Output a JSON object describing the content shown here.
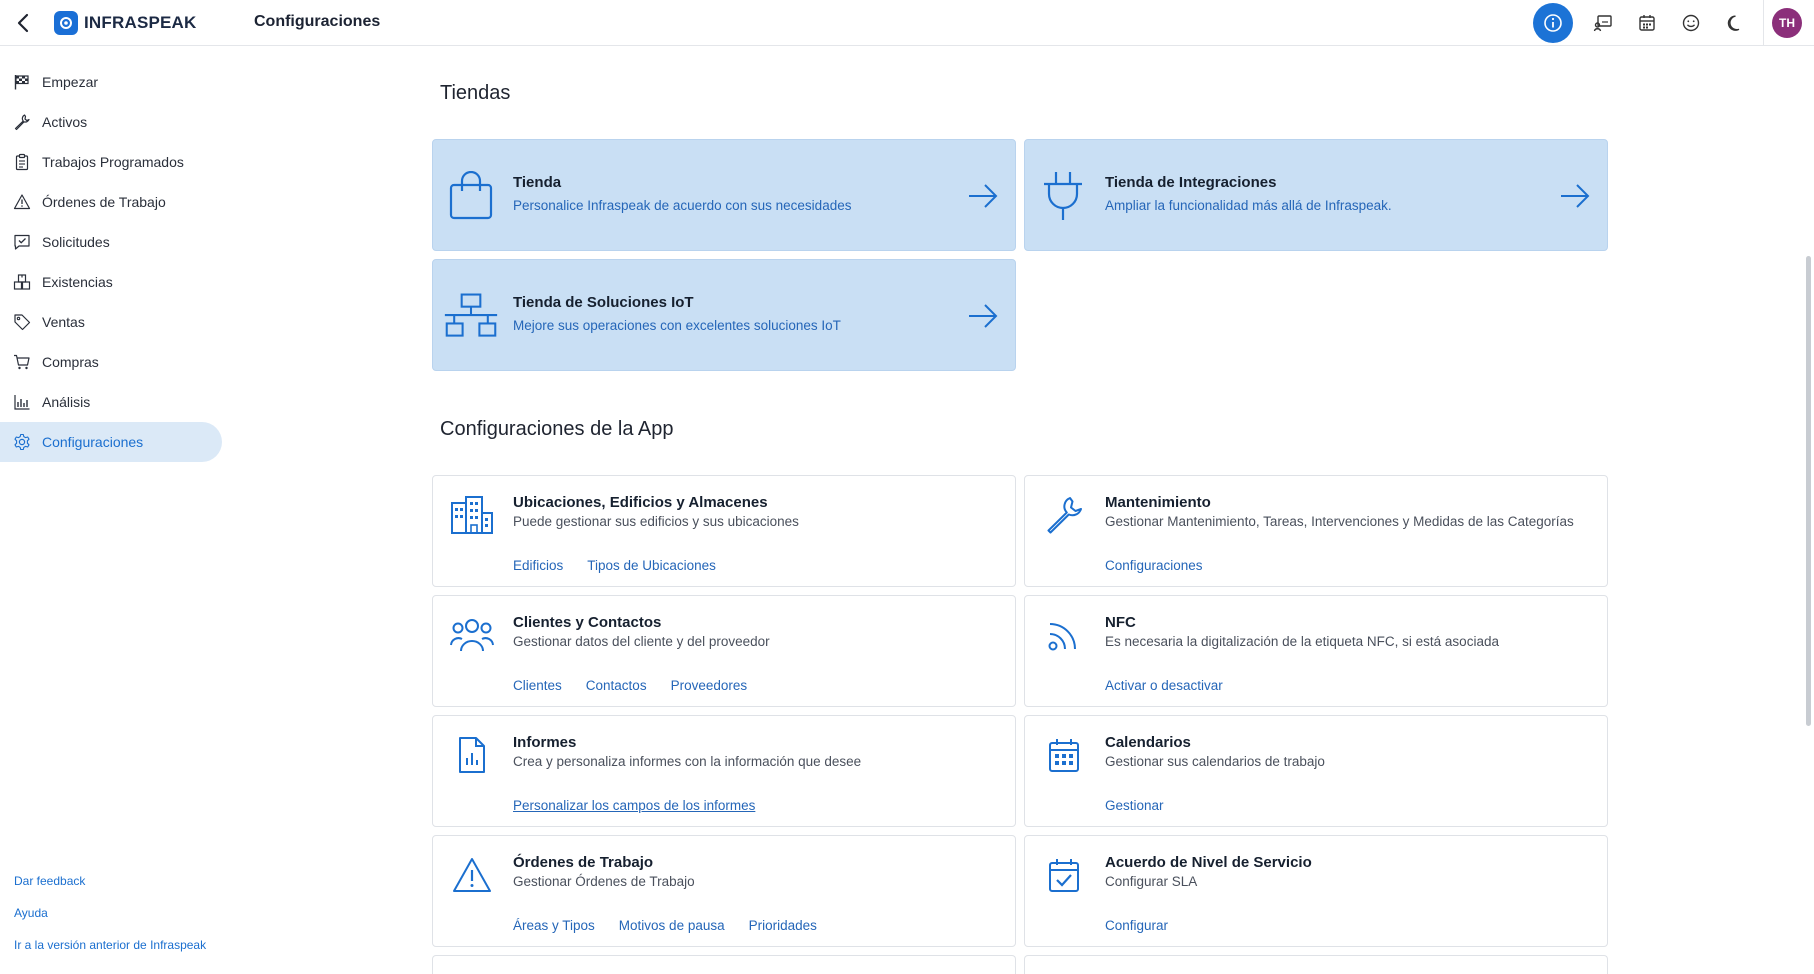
{
  "header": {
    "brand": "INFRASPEAK",
    "title": "Configuraciones",
    "avatar_initials": "TH",
    "icons": [
      "info-icon",
      "whiteboard-icon",
      "calendar-icon",
      "smile-icon",
      "moon-icon"
    ]
  },
  "sidebar": {
    "items": [
      {
        "label": "Empezar",
        "icon": "flag-icon"
      },
      {
        "label": "Activos",
        "icon": "wrench-icon"
      },
      {
        "label": "Trabajos Programados",
        "icon": "clipboard-icon"
      },
      {
        "label": "Órdenes de Trabajo",
        "icon": "warning-icon"
      },
      {
        "label": "Solicitudes",
        "icon": "chat-check-icon"
      },
      {
        "label": "Existencias",
        "icon": "boxes-icon"
      },
      {
        "label": "Ventas",
        "icon": "tag-icon"
      },
      {
        "label": "Compras",
        "icon": "cart-icon"
      },
      {
        "label": "Análisis",
        "icon": "bar-chart-icon"
      },
      {
        "label": "Configuraciones",
        "icon": "gear-icon",
        "active": true
      }
    ],
    "footer_links": [
      "Dar feedback",
      "Ayuda",
      "Ir a la versión anterior de Infraspeak"
    ]
  },
  "stores": {
    "title": "Tiendas",
    "cards": [
      {
        "title": "Tienda",
        "desc": "Personalice Infraspeak de acuerdo con sus necesidades",
        "icon": "shopping-bag-icon"
      },
      {
        "title": "Tienda de Integraciones",
        "desc": "Ampliar la funcionalidad más allá de Infraspeak.",
        "icon": "plug-icon"
      },
      {
        "title": "Tienda de Soluciones IoT",
        "desc": "Mejore sus operaciones con excelentes soluciones IoT",
        "icon": "network-icon"
      }
    ]
  },
  "app_settings": {
    "title": "Configuraciones de la App",
    "cards": [
      {
        "title": "Ubicaciones, Edificios y Almacenes",
        "desc": "Puede gestionar sus edificios y sus ubicaciones",
        "links": [
          "Edificios",
          "Tipos de Ubicaciones"
        ],
        "icon": "buildings-icon"
      },
      {
        "title": "Mantenimiento",
        "desc": "Gestionar Mantenimiento, Tareas, Intervenciones y Medidas de las Categorías",
        "links": [
          "Configuraciones"
        ],
        "icon": "wrench-icon"
      },
      {
        "title": "Clientes y Contactos",
        "desc": "Gestionar datos del cliente y del proveedor",
        "links": [
          "Clientes",
          "Contactos",
          "Proveedores"
        ],
        "icon": "people-icon"
      },
      {
        "title": "NFC",
        "desc": "Es necesaria la digitalización de la etiqueta NFC, si está asociada",
        "links": [
          "Activar o desactivar"
        ],
        "icon": "nfc-icon"
      },
      {
        "title": "Informes",
        "desc": "Crea y personaliza informes con la información que desee",
        "links": [
          "Personalizar los campos de los informes"
        ],
        "icon": "report-icon"
      },
      {
        "title": "Calendarios",
        "desc": "Gestionar sus calendarios de trabajo",
        "links": [
          "Gestionar"
        ],
        "icon": "calendar-icon"
      },
      {
        "title": "Órdenes de Trabajo",
        "desc": "Gestionar Órdenes de Trabajo",
        "links": [
          "Áreas y Tipos",
          "Motivos de pausa",
          "Prioridades"
        ],
        "icon": "warning-icon"
      },
      {
        "title": "Acuerdo de Nivel de Servicio",
        "desc": "Configurar SLA",
        "links": [
          "Configurar"
        ],
        "icon": "calendar-check-icon"
      }
    ]
  },
  "colors": {
    "accent": "#1c73d6",
    "store_card_bg": "#c9dff4",
    "active_nav_bg": "#dbe9f7",
    "avatar_bg": "#8b2f7a"
  }
}
